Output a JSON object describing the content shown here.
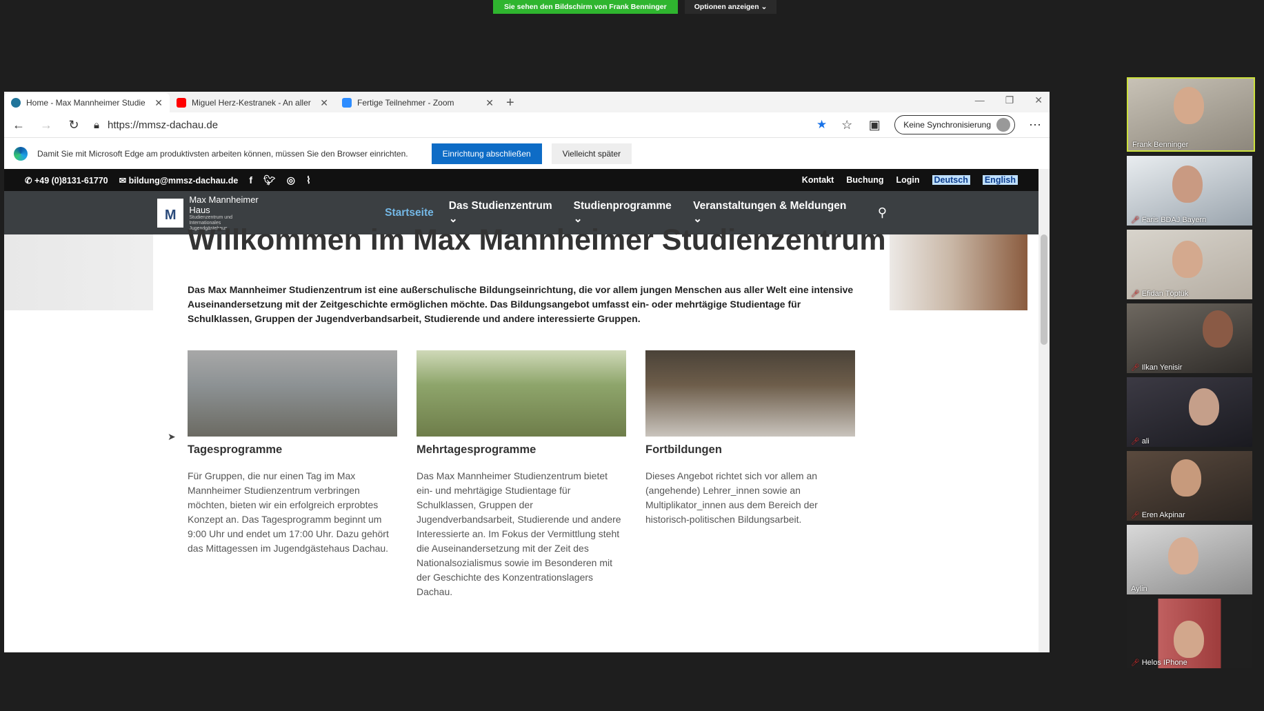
{
  "zoom": {
    "share_text": "Sie sehen den Bildschirm von Frank Benninger",
    "options_text": "Optionen anzeigen ⌄",
    "participants": [
      {
        "name": "Frank Benninger",
        "muted": false
      },
      {
        "name": "Faris BDAJ Bayern",
        "muted": true
      },
      {
        "name": "Efidan Töptük",
        "muted": true
      },
      {
        "name": "Ilkan Yenisir",
        "muted": true
      },
      {
        "name": "ali",
        "muted": true
      },
      {
        "name": "Eren Akpinar",
        "muted": true
      },
      {
        "name": "Aylin",
        "muted": false
      },
      {
        "name": "Helos IPhone",
        "muted": true
      }
    ]
  },
  "browser": {
    "tabs": [
      {
        "label": "Home - Max Mannheimer Studie",
        "icon": "wordpress-icon",
        "color": "#21759b"
      },
      {
        "label": "Miguel Herz-Kestranek - An aller",
        "icon": "youtube-icon",
        "color": "#ff0000"
      },
      {
        "label": "Fertige Teilnehmer - Zoom",
        "icon": "zoom-icon",
        "color": "#2d8cff"
      }
    ],
    "url": "https://mmsz-dachau.de",
    "sync_label": "Keine Synchronisierung",
    "infobar": {
      "text": "Damit Sie mit Microsoft Edge am produktivsten arbeiten können, müssen Sie den Browser einrichten.",
      "primary": "Einrichtung abschließen",
      "secondary": "Vielleicht später"
    }
  },
  "site": {
    "topbar": {
      "phone": "+49 (0)8131-61770",
      "email": "bildung@mmsz-dachau.de",
      "links": [
        "Kontakt",
        "Buchung",
        "Login"
      ],
      "languages": [
        "Deutsch",
        "English"
      ]
    },
    "logo": {
      "name": "Max Mannheimer Haus",
      "sub": "Studienzentrum und Internationales Jugendgästehaus"
    },
    "nav": [
      "Startseite",
      "Das Studienzentrum ⌄",
      "Studienprogramme ⌄",
      "Veranstaltungen & Meldungen ⌄"
    ],
    "welcome": "Willkommen im Max Mannheimer Studienzentrum",
    "intro": "Das Max Mannheimer Studienzentrum ist eine außerschulische Bildungseinrichtung, die vor allem jungen Menschen aus aller Welt eine intensive Auseinandersetzung mit der Zeitgeschichte ermöglichen möchte. Das Bildungsangebot umfasst ein- oder mehrtägige Studientage für Schulklassen, Gruppen der Jugendverbandsarbeit, Studierende und andere interessierte Gruppen.",
    "cards": [
      {
        "title": "Tagesprogramme",
        "text": "Für Gruppen, die nur einen Tag im Max Mannheimer Studienzentrum verbringen möchten, bieten wir ein erfolgreich erprobtes Konzept an. Das Tagesprogramm beginnt um 9:00 Uhr und endet um 17:00 Uhr. Dazu gehört das Mittagessen im Jugendgästehaus Dachau."
      },
      {
        "title": "Mehrtagesprogramme",
        "text": "Das Max Mannheimer Studienzentrum bietet ein- und mehrtägige Studientage für Schulklassen, Gruppen der Jugendverbandsarbeit, Studierende und andere Interessierte an. Im Fokus der Vermittlung steht die Auseinandersetzung mit der Zeit des Nationalsozialismus sowie im Besonderen mit der Geschichte des Konzentrationslagers Dachau."
      },
      {
        "title": "Fortbildungen",
        "text": "Dieses Angebot richtet sich vor allem an (angehende) Lehrer_innen sowie an Multiplikator_innen aus dem Bereich der historisch-politischen Bildungsarbeit."
      }
    ]
  }
}
